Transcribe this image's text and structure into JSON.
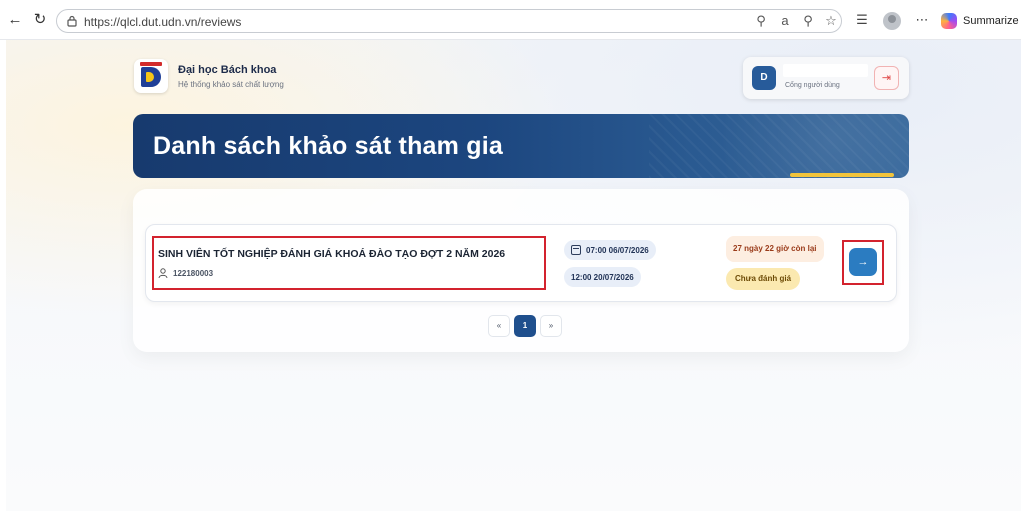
{
  "browser": {
    "url": "https://qlcl.dut.udn.vn/reviews",
    "summarize_label": "Summarize"
  },
  "header": {
    "university_name": "Đại học Bách khoa",
    "system_name": "Hệ thống khảo sát chất lượng",
    "user_initial": "D",
    "user_role": "Cổng người dùng"
  },
  "banner": {
    "title": "Danh sách khảo sát tham gia"
  },
  "surveys": [
    {
      "title": "SINH VIÊN TỐT NGHIỆP ĐÁNH GIÁ KHOÁ ĐÀO TẠO ĐỢT 2 NĂM 2026",
      "participant_id": "122180003",
      "start": "07:00 06/07/2026",
      "end": "12:00 20/07/2026",
      "remaining": "27 ngày 22 giờ còn lại",
      "status": "Chưa đánh giá"
    }
  ],
  "pagination": {
    "prev": "«",
    "current": "1",
    "next": "»"
  },
  "colors": {
    "primary": "#1f4f8d",
    "highlight_border": "#d3232e",
    "accent": "#f2c43b"
  }
}
